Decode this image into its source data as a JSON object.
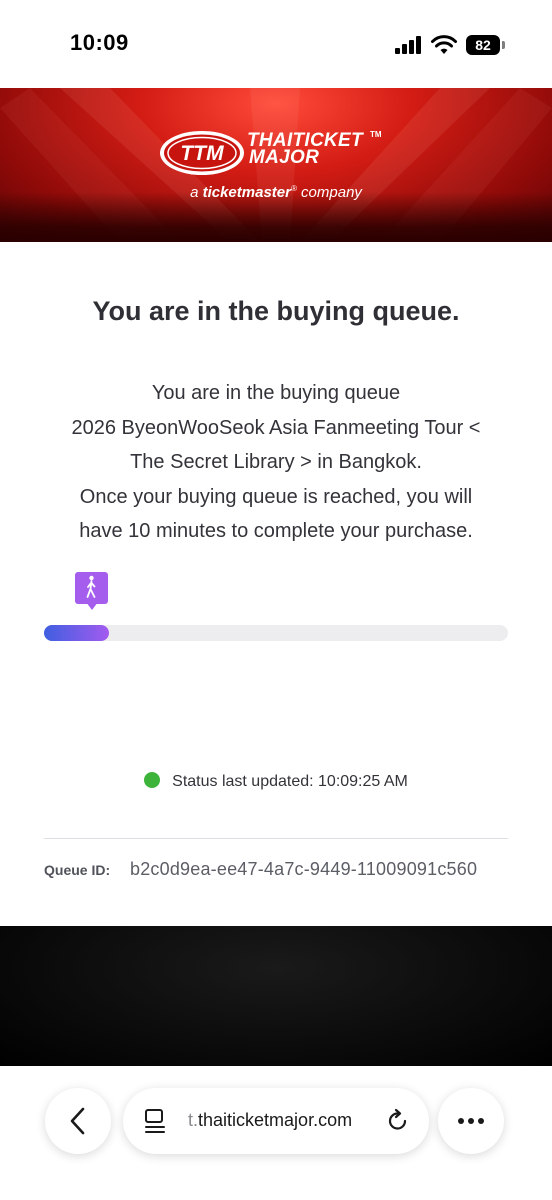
{
  "status_bar": {
    "time": "10:09",
    "battery": "82"
  },
  "banner": {
    "logo_line1": "THAITICKET",
    "logo_line2": "MAJOR",
    "logo_tm": "TM",
    "tagline_prefix": "a",
    "tagline_brand": "ticketmaster",
    "tagline_mark": "®",
    "tagline_suffix": "company"
  },
  "queue": {
    "heading": "You are in the buying queue.",
    "description_lines": [
      "You are in the buying queue",
      "2026 ByeonWooSeok Asia Fanmeeting Tour <",
      "The Secret Library > in Bangkok.",
      "Once your buying queue is reached, you will",
      "have 10 minutes to complete your purchase."
    ],
    "progress_fraction": 0.14,
    "status_text": "Status last updated: 10:09:25 AM",
    "queue_id_label": "Queue ID:",
    "queue_id_value": "b2c0d9ea-ee47-4a7c-9449-11009091c560"
  },
  "browser": {
    "url_prefix": "t.",
    "url_domain": "thaiticketmajor.com",
    "back_icon": "chevron-left-icon",
    "reader_icon": "reader-mode-icon",
    "reload_icon": "reload-icon",
    "more_icon": "more-icon"
  },
  "colors": {
    "brand_red": "#d31c14",
    "progress_start": "#3f5fe0",
    "progress_end": "#a35bef",
    "status_ok": "#3db33a"
  }
}
